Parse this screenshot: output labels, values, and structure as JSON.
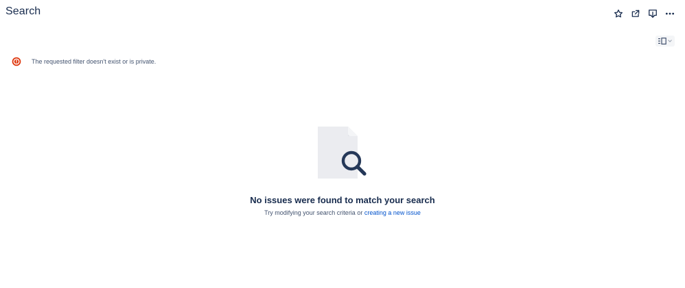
{
  "header": {
    "title": "Search",
    "actions": [
      {
        "icon": "star-icon"
      },
      {
        "icon": "share-icon"
      },
      {
        "icon": "export-icon"
      },
      {
        "icon": "more-icon"
      }
    ]
  },
  "toolbar": {
    "view_toggle_icon": "list-detail-view-icon"
  },
  "error": {
    "icon": "error-icon",
    "message": "The requested filter doesn't exist or is private."
  },
  "empty_state": {
    "heading": "No issues were found to match your search",
    "subtext_prefix": "Try modifying your search criteria or ",
    "link_text": "creating a new issue"
  },
  "colors": {
    "text_primary": "#172b4d",
    "text_secondary": "#42526e",
    "link": "#0052cc",
    "error": "#de350b"
  }
}
